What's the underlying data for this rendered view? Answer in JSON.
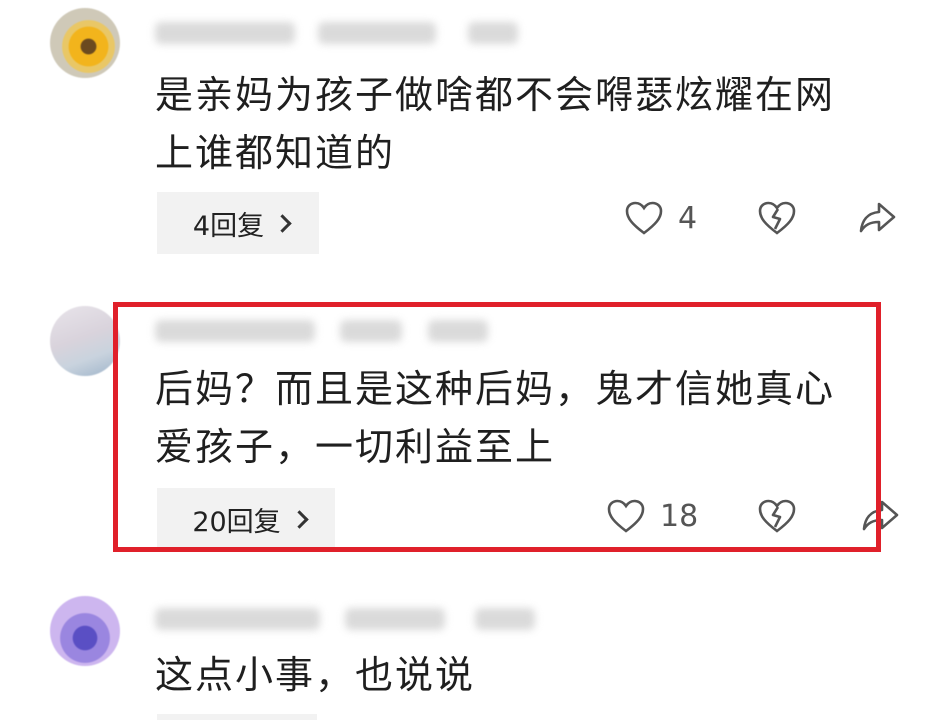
{
  "comments": [
    {
      "text": "是亲妈为孩子做啥都不会嘚瑟炫耀在网\n上谁都知道的",
      "replies_label": "4回复",
      "like_count": "4"
    },
    {
      "text": "后妈？而且是这种后妈，鬼才信她真心\n爱孩子，一切利益至上",
      "replies_label": "20回复",
      "like_count": "18"
    },
    {
      "text": "这点小事，也说说"
    }
  ],
  "icons": {
    "like": "heart-outline-icon",
    "dislike": "broken-heart-icon",
    "share": "share-arrow-icon",
    "reply_chevron": "chevron-right-icon"
  },
  "colors": {
    "highlight_border": "#e0202a",
    "reply_button_bg": "#f2f2f2",
    "icon_gray": "#555555"
  }
}
